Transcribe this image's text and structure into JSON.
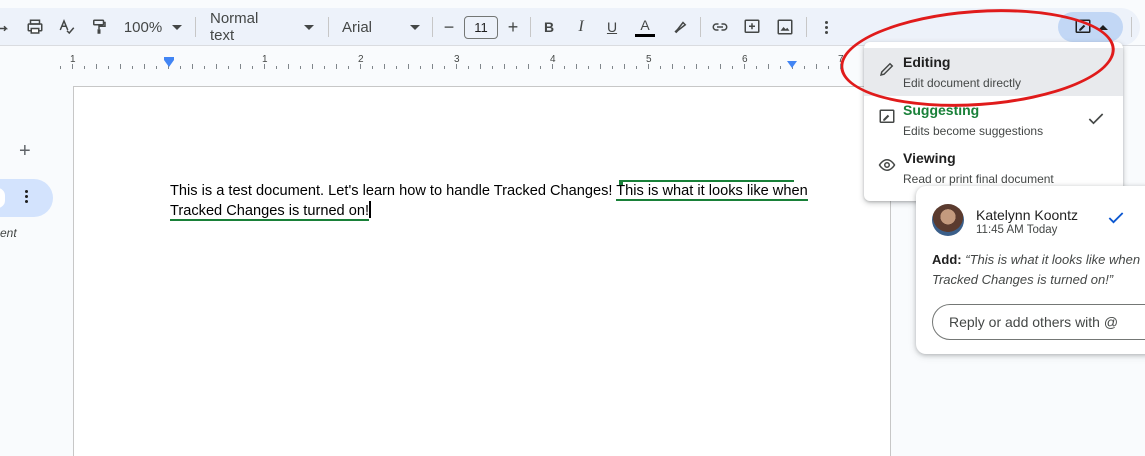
{
  "toolbar": {
    "zoom": "100%",
    "style": "Normal text",
    "font": "Arial",
    "font_size": "11",
    "minus": "−",
    "plus": "+",
    "bold": "B",
    "italic": "I",
    "underline": "U",
    "text_color_letter": "A"
  },
  "ruler": {
    "numbers": [
      "1",
      "1",
      "2",
      "3",
      "4",
      "5",
      "6",
      "7"
    ]
  },
  "sidebar": {
    "add": "+",
    "tab_note": "ent"
  },
  "document": {
    "text_plain": "This is a test document. Let's learn how to handle Tracked Changes! ",
    "text_suggested": "This is what it looks like when Tracked Changes is turned on!"
  },
  "mode_menu": {
    "items": [
      {
        "title": "Editing",
        "desc": "Edit document directly",
        "icon": "pencil-icon"
      },
      {
        "title": "Suggesting",
        "desc": "Edits become suggestions",
        "icon": "suggest-icon"
      },
      {
        "title": "Viewing",
        "desc": "Read or print final document",
        "icon": "eye-icon"
      }
    ]
  },
  "comment": {
    "author": "Katelynn Koontz",
    "time": "11:45 AM Today",
    "label": "Add:",
    "text": "“This is what it looks like when",
    "text2": "Tracked Changes is turned on!”",
    "reply_placeholder": "Reply or add others with @"
  },
  "colors": {
    "suggest_green": "#188038",
    "annotation_red": "#e01b1b",
    "accent_blue": "#0b57d0"
  }
}
